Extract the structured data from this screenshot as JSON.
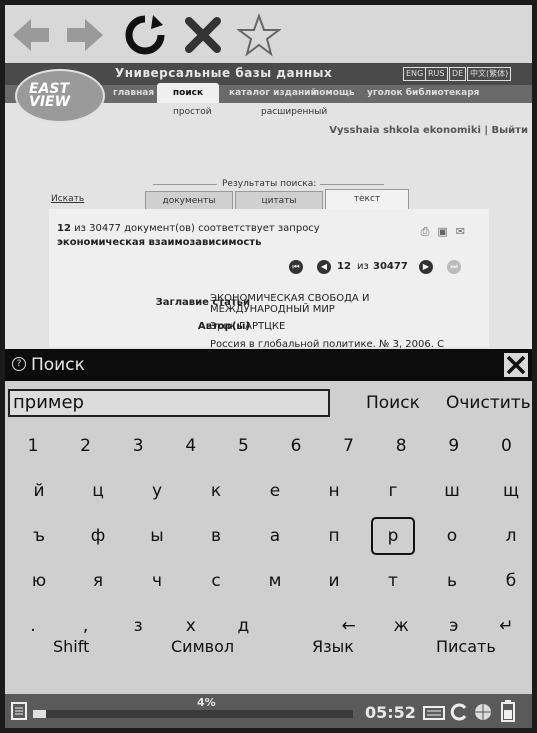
{
  "browser": {
    "toolbar": [
      "back-arrow-icon",
      "forward-arrow-icon",
      "refresh-icon",
      "stop-icon",
      "bookmark-star-icon"
    ]
  },
  "site": {
    "banner_title": "Универсальные базы данных",
    "lang_options": [
      "ENG",
      "RUS",
      "DE",
      "中文(繁体)"
    ],
    "logo_text": "EAST VIEW",
    "nav": [
      "главная",
      "поиск",
      "каталог изданий",
      "помощь",
      "уголок библиотекаря"
    ],
    "nav_active": "поиск",
    "subnav_simple": "простой",
    "subnav_advanced": "расширенный",
    "institution": "Vysshaia shkola ekonomiki | Выйти",
    "results_label": "Результаты поиска:",
    "search_link": "Искать",
    "tabs": [
      "документы",
      "цитаты",
      "текст"
    ],
    "result_summary_count": "12",
    "result_summary_text": "из 30477 документ(ов) соответствует запросу",
    "result_query": "экономическая взаимозависимость",
    "pager_current": "12",
    "pager_of": "из",
    "pager_total": "30477",
    "article_title_label": "Заглавие статьи",
    "article_title_value": "ЭКОНОМИЧЕСКАЯ СВОБОДА И МЕЖДУНАРОДНЫЙ МИР",
    "author_label": "Автор(ы)",
    "author_value": "Эрик ГАРТЦКЕ",
    "source_partial": "Россия в глобальной политике. № 3, 2006. С"
  },
  "dialog": {
    "title": "Поиск",
    "input_value": "пример",
    "search_button": "Поиск",
    "clear_button": "Очистить",
    "rows": [
      [
        "1",
        "2",
        "3",
        "4",
        "5",
        "6",
        "7",
        "8",
        "9",
        "0"
      ],
      [
        "й",
        "ц",
        "у",
        "к",
        "е",
        "н",
        "г",
        "ш",
        "щ"
      ],
      [
        "ъ",
        "ф",
        "ы",
        "в",
        "а",
        "п",
        "р",
        "о",
        "л"
      ],
      [
        "ю",
        "я",
        "ч",
        "с",
        "м",
        "и",
        "т",
        "ь",
        "б"
      ],
      [
        ".",
        ",",
        "з",
        "х",
        "д",
        "",
        "←",
        "ж",
        "э",
        "↵"
      ]
    ],
    "highlighted_key": "р",
    "shift": "Shift",
    "symbol": "Символ",
    "language": "Язык",
    "write": "Писать"
  },
  "status": {
    "progress_percent": 4,
    "progress_label": "4%",
    "time": "05:52"
  }
}
